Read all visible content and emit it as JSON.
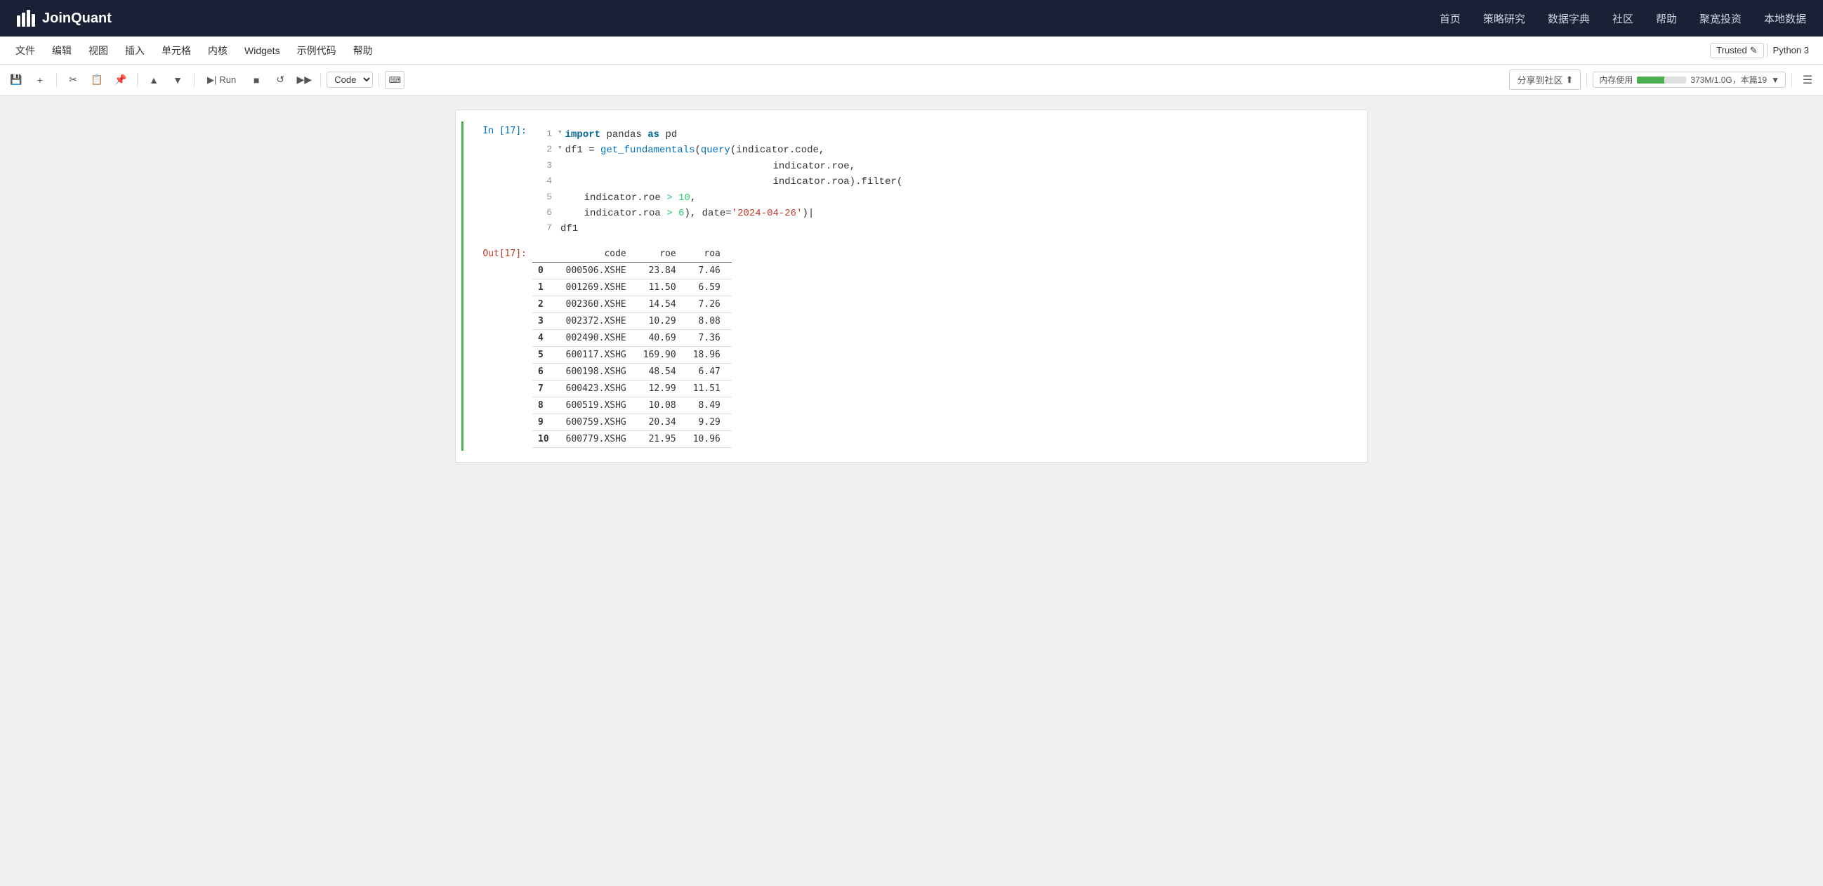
{
  "topnav": {
    "logo_text": "JoinQuant",
    "nav_items": [
      "首页",
      "策略研究",
      "数据字典",
      "社区",
      "帮助",
      "聚宽投资",
      "本地数据"
    ]
  },
  "menubar": {
    "items": [
      "文件",
      "编辑",
      "视图",
      "插入",
      "单元格",
      "内核",
      "Widgets",
      "示例代码",
      "帮助"
    ],
    "trusted": "Trusted",
    "kernel": "Python 3"
  },
  "toolbar": {
    "run_label": "Run",
    "cell_type": "Code",
    "share_label": "分享到社区",
    "memory_label": "内存使用",
    "memory_value": "373M/1.0G，本篇19"
  },
  "cell": {
    "in_label": "In [17]:",
    "out_label": "Out[17]:",
    "code_lines": [
      {
        "num": 1,
        "fold": true,
        "content": "import pandas as pd",
        "tokens": [
          {
            "t": "kw",
            "v": "import"
          },
          {
            "t": "plain",
            "v": " pandas "
          },
          {
            "t": "kw",
            "v": "as"
          },
          {
            "t": "plain",
            "v": " pd"
          }
        ]
      },
      {
        "num": 2,
        "fold": true,
        "content": "df1 = get_fundamentals(query(indicator.code,",
        "tokens": [
          {
            "t": "plain",
            "v": "df1 = "
          },
          {
            "t": "fn",
            "v": "get_fundamentals"
          },
          {
            "t": "plain",
            "v": "("
          },
          {
            "t": "fn",
            "v": "query"
          },
          {
            "t": "plain",
            "v": "(indicator.code,"
          }
        ]
      },
      {
        "num": 3,
        "fold": false,
        "content": "                                    indicator.roe,",
        "tokens": [
          {
            "t": "plain",
            "v": "                                    indicator.roe,"
          }
        ]
      },
      {
        "num": 4,
        "fold": false,
        "content": "                                    indicator.roa).filter(",
        "tokens": [
          {
            "t": "plain",
            "v": "                                    indicator.roa).filter("
          }
        ]
      },
      {
        "num": 5,
        "fold": false,
        "content": "    indicator.roe > 10,",
        "tokens": [
          {
            "t": "plain",
            "v": "    indicator.roe "
          },
          {
            "t": "gt",
            "v": ">"
          },
          {
            "t": "num",
            "v": " 10"
          },
          {
            "t": "plain",
            "v": ","
          }
        ]
      },
      {
        "num": 6,
        "fold": false,
        "content": "    indicator.roa > 6), date='2024-04-26')|",
        "tokens": [
          {
            "t": "plain",
            "v": "    indicator.roa "
          },
          {
            "t": "gt",
            "v": ">"
          },
          {
            "t": "num",
            "v": " 6"
          },
          {
            "t": "plain",
            "v": "), date="
          },
          {
            "t": "str",
            "v": "'2024-04-26'"
          },
          {
            "t": "plain",
            "v": ")|"
          }
        ]
      },
      {
        "num": 7,
        "fold": false,
        "content": "df1",
        "tokens": [
          {
            "t": "plain",
            "v": "df1"
          }
        ]
      }
    ]
  },
  "table": {
    "headers": [
      "",
      "code",
      "roe",
      "roa"
    ],
    "rows": [
      [
        "0",
        "000506.XSHE",
        "23.84",
        "7.46"
      ],
      [
        "1",
        "001269.XSHE",
        "11.50",
        "6.59"
      ],
      [
        "2",
        "002360.XSHE",
        "14.54",
        "7.26"
      ],
      [
        "3",
        "002372.XSHE",
        "10.29",
        "8.08"
      ],
      [
        "4",
        "002490.XSHE",
        "40.69",
        "7.36"
      ],
      [
        "5",
        "600117.XSHG",
        "169.90",
        "18.96"
      ],
      [
        "6",
        "600198.XSHG",
        "48.54",
        "6.47"
      ],
      [
        "7",
        "600423.XSHG",
        "12.99",
        "11.51"
      ],
      [
        "8",
        "600519.XSHG",
        "10.08",
        "8.49"
      ],
      [
        "9",
        "600759.XSHG",
        "20.34",
        "9.29"
      ],
      [
        "10",
        "600779.XSHG",
        "21.95",
        "10.96"
      ]
    ]
  }
}
